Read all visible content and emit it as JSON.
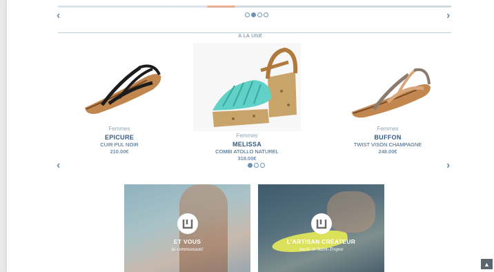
{
  "top_carousel": {
    "prev_icon": "‹",
    "next_icon": "›",
    "dots": 4,
    "active_dot": 1
  },
  "section": {
    "title": "A LA UNE"
  },
  "products": [
    {
      "category": "Femmes",
      "name": "EPICURE",
      "desc": "CUIR PUL NOIR",
      "price": "210.00€"
    },
    {
      "category": "Femmes",
      "name": "MELISSA",
      "desc": "COMBI ATOLLO NATUREL",
      "price": "318.00€"
    },
    {
      "category": "Femmes",
      "name": "BUFFON",
      "desc": "TWIST VISON CHAMPAGNE",
      "price": "248.00€"
    }
  ],
  "product_carousel": {
    "prev_icon": "‹",
    "next_icon": "›",
    "dots": 3,
    "active_dot": 0
  },
  "tiles": [
    {
      "title": "ET VOUS",
      "subtitle": "la communauté"
    },
    {
      "title": "L'ARTISAN CRÉATEUR",
      "subtitle": "made in Saint-Tropez"
    }
  ],
  "back_to_top": {
    "icon": "▲"
  },
  "colors": {
    "accent": "#335a80",
    "light_accent": "#6f93b3",
    "sole": "#c2874f",
    "turquoise": "#5fd1c6"
  }
}
